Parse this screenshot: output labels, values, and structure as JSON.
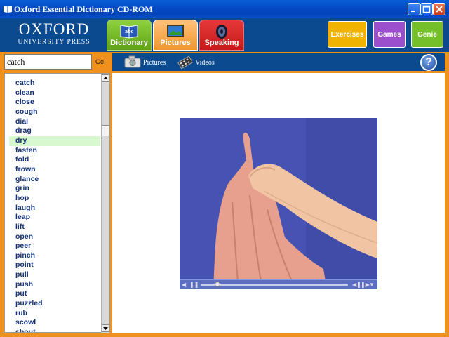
{
  "window": {
    "title": "Oxford Essential Dictionary CD-ROM"
  },
  "brand": {
    "line1": "OXFORD",
    "line2": "UNIVERSITY PRESS"
  },
  "tabs": [
    {
      "label": "Dictionary",
      "icon": "abc-book-icon"
    },
    {
      "label": "Pictures",
      "icon": "picture-frame-icon"
    },
    {
      "label": "Speaking",
      "icon": "speaker-icon"
    }
  ],
  "tools": {
    "exercises": "Exercises",
    "games": "Games",
    "genie": "Genie"
  },
  "search": {
    "value": "catch",
    "go_label": "Go"
  },
  "media": {
    "pictures_label": "Pictures",
    "videos_label": "Videos",
    "help_label": "?"
  },
  "words": [
    "catch",
    "clean",
    "close",
    "cough",
    "dial",
    "drag",
    "dry",
    "fasten",
    "fold",
    "frown",
    "glance",
    "grin",
    "hop",
    "laugh",
    "leap",
    "lift",
    "open",
    "peer",
    "pinch",
    "point",
    "pull",
    "push",
    "put",
    "puzzled",
    "rub",
    "scowl",
    "shout"
  ],
  "selected_word": "dry",
  "colors": {
    "accent_orange": "#f0901e",
    "header_blue": "#0b4a8e",
    "selection_green": "#d8f8d0"
  }
}
